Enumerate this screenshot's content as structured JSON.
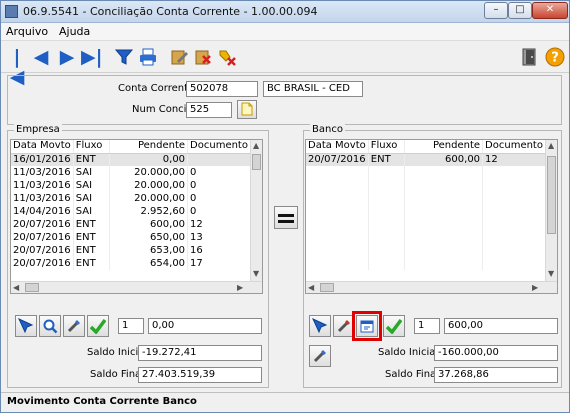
{
  "window": {
    "title": "06.9.5541 - Conciliação Conta Corrente - 1.00.00.094"
  },
  "menu": [
    "Arquivo",
    "Ajuda"
  ],
  "header": {
    "conta_label": "Conta Corrente:",
    "conta_value": "502078",
    "banco_name": "BC BRASIL - CED",
    "concil_label": "Num Concil:",
    "concil_value": "525"
  },
  "empresa": {
    "legend": "Empresa",
    "columns": [
      "Data Movto",
      "Fluxo",
      "Pendente",
      "Documento"
    ],
    "rows": [
      [
        "16/01/2016",
        "ENT",
        "0,00",
        ""
      ],
      [
        "11/03/2016",
        "SAI",
        "20.000,00",
        "0"
      ],
      [
        "11/03/2016",
        "SAI",
        "20.000,00",
        "0"
      ],
      [
        "11/03/2016",
        "SAI",
        "20.000,00",
        "0"
      ],
      [
        "14/04/2016",
        "SAI",
        "2.952,60",
        "0"
      ],
      [
        "20/07/2016",
        "ENT",
        "600,00",
        "12"
      ],
      [
        "20/07/2016",
        "ENT",
        "650,00",
        "13"
      ],
      [
        "20/07/2016",
        "ENT",
        "653,00",
        "16"
      ],
      [
        "20/07/2016",
        "ENT",
        "654,00",
        "17"
      ]
    ],
    "count": "1",
    "total": "0,00",
    "saldo_inicial_label": "Saldo Inicial:",
    "saldo_inicial": "-19.272,41",
    "saldo_final_label": "Saldo Final:",
    "saldo_final": "27.403.519,39"
  },
  "banco": {
    "legend": "Banco",
    "columns": [
      "Data Movto",
      "Fluxo",
      "Pendente",
      "Documento"
    ],
    "rows": [
      [
        "20/07/2016",
        "ENT",
        "600,00",
        "12"
      ]
    ],
    "count": "1",
    "total": "600,00",
    "saldo_inicial_label": "Saldo Inicial:",
    "saldo_inicial": "-160.000,00",
    "saldo_final_label": "Saldo Final:",
    "saldo_final": "37.268,86"
  },
  "status": "Movimento Conta Corrente Banco",
  "colors": {
    "highlight": "#e00000",
    "nav_blue": "#1f5fc4",
    "check_green": "#2aa82a"
  }
}
